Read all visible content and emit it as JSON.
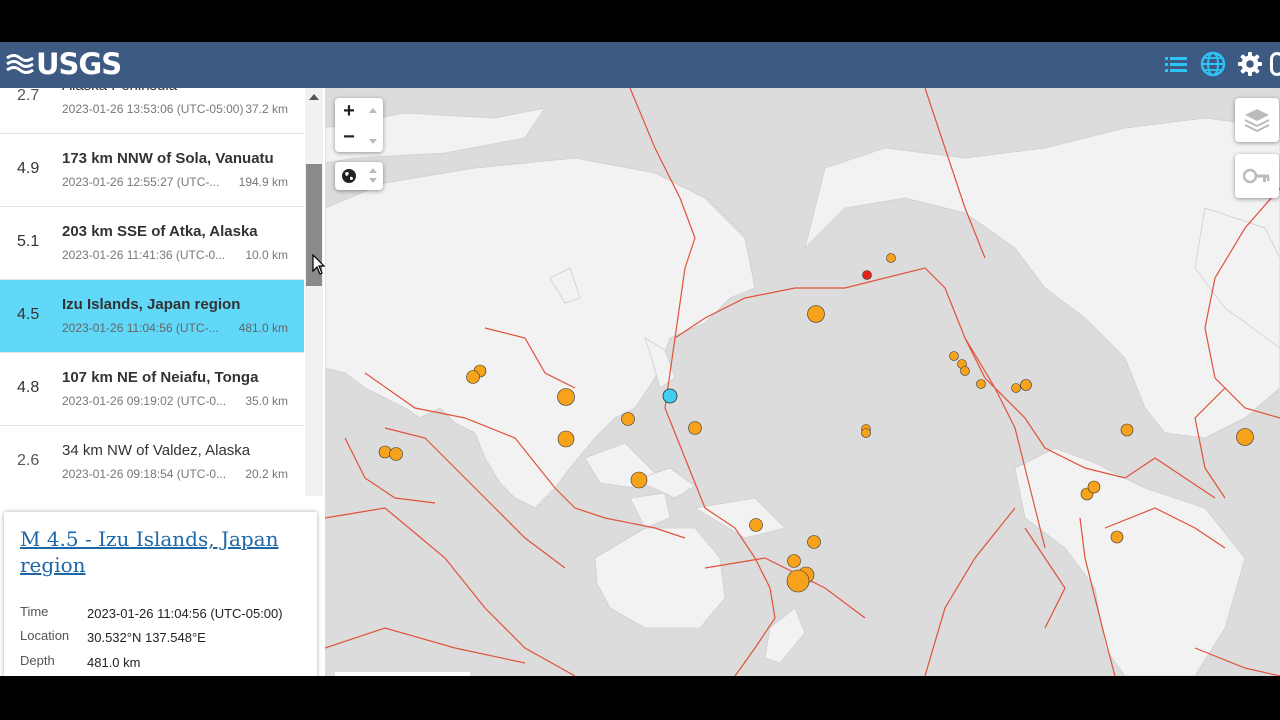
{
  "header": {
    "logo_text": "USGS",
    "icons": [
      "list-icon",
      "globe-icon",
      "gear-icon"
    ]
  },
  "event_list": [
    {
      "mag": "2.7",
      "place": "Alaska Peninsula",
      "time": "2023-01-26 13:53:06 (UTC-05:00)",
      "depth": "37.2 km",
      "selected": false
    },
    {
      "mag": "4.9",
      "place": "173 km NNW of Sola, Vanuatu",
      "time": "2023-01-26 12:55:27 (UTC-...",
      "depth": "194.9 km",
      "selected": false
    },
    {
      "mag": "5.1",
      "place": "203 km SSE of Atka, Alaska",
      "time": "2023-01-26 11:41:36 (UTC-0...",
      "depth": "10.0 km",
      "selected": false
    },
    {
      "mag": "4.5",
      "place": "Izu Islands, Japan region",
      "time": "2023-01-26 11:04:56 (UTC-...",
      "depth": "481.0 km",
      "selected": true
    },
    {
      "mag": "4.8",
      "place": "107 km NE of Neiafu, Tonga",
      "time": "2023-01-26 09:19:02 (UTC-0...",
      "depth": "35.0 km",
      "selected": false
    },
    {
      "mag": "2.6",
      "place": "34 km NW of Valdez, Alaska",
      "time": "2023-01-26 09:18:54 (UTC-0...",
      "depth": "20.2 km",
      "selected": false
    }
  ],
  "detail_card": {
    "title": "M 4.5 - Izu Islands, Japan region",
    "time_label": "Time",
    "time_value": "2023-01-26 11:04:56 (UTC-05:00)",
    "location_label": "Location",
    "location_value": "30.532°N 137.548°E",
    "depth_label": "Depth",
    "depth_value": "481.0 km"
  },
  "map_controls": {
    "zoom_in": "+",
    "zoom_out": "−"
  },
  "colors": {
    "header": "#3d5a82",
    "selected_row": "#61d8f8",
    "event_orange": "#f7a21b",
    "event_red": "#e8221d",
    "event_selected": "#3fd0f0",
    "plate_boundary": "#e0523a"
  }
}
